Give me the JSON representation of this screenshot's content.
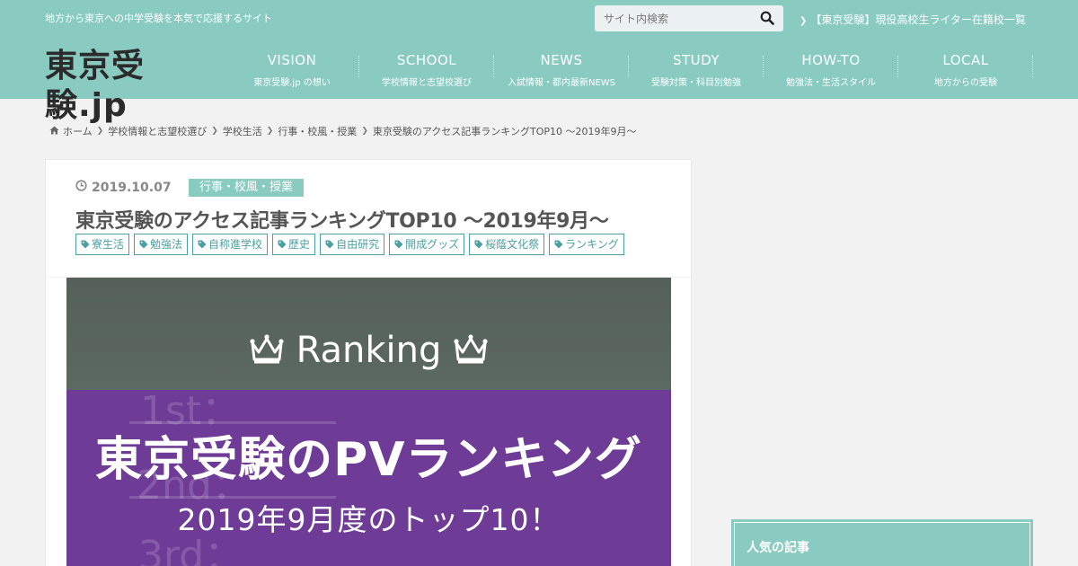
{
  "header": {
    "tagline": "地方から東京への中学受験を本気で応援するサイト",
    "logo_text": "東京受験.jp",
    "search": {
      "placeholder": "サイト内検索",
      "icon": "search-icon"
    },
    "top_link": "【東京受験】現役高校生ライター在籍校一覧",
    "bg_color": "#89cbc1"
  },
  "nav": [
    {
      "title": "VISION",
      "sub": "東京受験.jp の想い"
    },
    {
      "title": "SCHOOL",
      "sub": "学校情報と志望校選び"
    },
    {
      "title": "NEWS",
      "sub": "入試情報・都内最新NEWS"
    },
    {
      "title": "STUDY",
      "sub": "受験対策・科目別勉強"
    },
    {
      "title": "HOW-TO",
      "sub": "勉強法・生活スタイル"
    },
    {
      "title": "LOCAL",
      "sub": "地方からの受験"
    }
  ],
  "breadcrumb": {
    "home": "ホーム",
    "items": [
      "学校情報と志望校選び",
      "学校生活",
      "行事・校風・授業"
    ],
    "current": "東京受験のアクセス記事ランキングTOP10 ～2019年9月～"
  },
  "article": {
    "date": "2019.10.07",
    "category": "行事・校風・授業",
    "title": "東京受験のアクセス記事ランキングTOP10 ～2019年9月～",
    "tags": [
      "寮生活",
      "勉強法",
      "自称進学校",
      "歴史",
      "自由研究",
      "開成グッズ",
      "桜蔭文化祭",
      "ランキング"
    ],
    "eyecatch": {
      "heading": "Ranking",
      "main": "東京受験のPVランキング",
      "sub": "2019年9月度のトップ10！",
      "ghost_labels": [
        "1st：",
        "2nd：",
        "3rd："
      ],
      "colors": {
        "chalkboard": "#55605b",
        "purple": "#6e3b96"
      }
    }
  },
  "sidebar": {
    "popular_title": "人気の記事"
  }
}
